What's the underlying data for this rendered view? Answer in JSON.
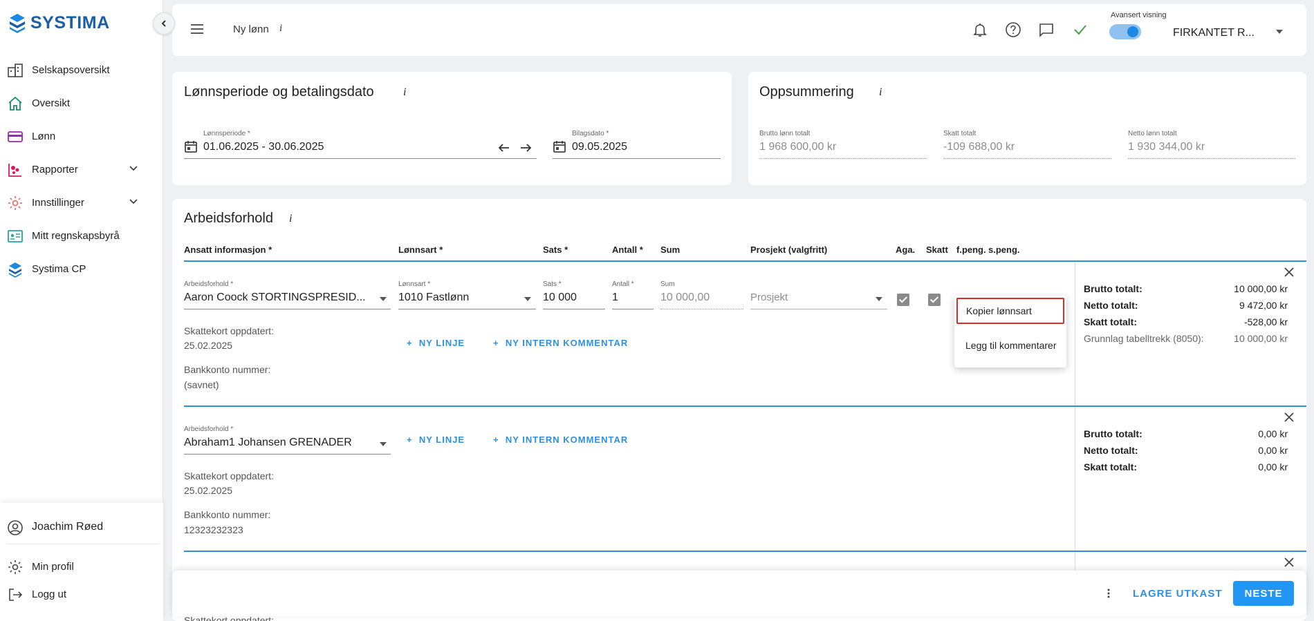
{
  "app": {
    "logo_text": "SYSTIMA",
    "accent": "#2196f3"
  },
  "sidebar": {
    "items": [
      {
        "label": "Selskapsoversikt",
        "icon": "company-building-icon"
      },
      {
        "label": "Oversikt",
        "icon": "home-icon"
      },
      {
        "label": "Lønn",
        "icon": "payment-card-icon"
      },
      {
        "label": "Rapporter",
        "icon": "reports-icon",
        "expandable": true
      },
      {
        "label": "Innstillinger",
        "icon": "gear-icon",
        "expandable": true
      },
      {
        "label": "Mitt regnskapsbyrå",
        "icon": "accounting-office-icon"
      },
      {
        "label": "Systima CP",
        "icon": "systima-logo-icon"
      }
    ],
    "user": {
      "name": "Joachim Røed"
    },
    "profile_label": "Min profil",
    "logout_label": "Logg ut"
  },
  "topbar": {
    "breadcrumb": "Ny lønn",
    "info": "i",
    "advanced_view_label": "Avansert visning",
    "advanced_view_on": true,
    "company": "FIRKANTET R..."
  },
  "period_card": {
    "title": "Lønnsperiode og betalingsdato",
    "info": "i",
    "period_label": "Lønnsperiode *",
    "period_value": "01.06.2025 - 30.06.2025",
    "voucher_date_label": "Bilagsdato *",
    "voucher_date_value": "09.05.2025"
  },
  "summary_card": {
    "title": "Oppsummering",
    "info": "i",
    "gross_label": "Brutto lønn totalt",
    "gross_value": "1 968 600,00 kr",
    "tax_label": "Skatt totalt",
    "tax_value": "-109 688,00 kr",
    "net_label": "Netto lønn totalt",
    "net_value": "1 930 344,00 kr"
  },
  "employment": {
    "title": "Arbeidsforhold",
    "info": "i",
    "columns": [
      "Ansatt informasjon *",
      "Lønnsart *",
      "Sats *",
      "Antall *",
      "Sum",
      "Prosjekt (valgfritt)",
      "Aga.",
      "Skatt",
      "f.peng.",
      "s.peng."
    ],
    "row1": {
      "employment_label": "Arbeidsforhold *",
      "employment_value": "Aaron Coock STORTINGSPRESID...",
      "wage_type_label": "Lønnsart *",
      "wage_type_value": "1010 Fastlønn",
      "rate_label": "Sats *",
      "rate_value": "10 000",
      "qty_label": "Antall *",
      "qty_value": "1",
      "sum_label": "Sum",
      "sum_value": "10 000,00",
      "project_placeholder": "Prosjekt",
      "taxcard_label": "Skattekort oppdatert:",
      "taxcard_date": "25.02.2025",
      "bank_label": "Bankkonto nummer:",
      "bank_value": "(savnet)",
      "add_line": "NY LINJE",
      "add_comment": "NY INTERN KOMMENTAR",
      "gross_label": "Brutto totalt:",
      "gross_value": "10 000,00 kr",
      "net_label": "Netto totalt:",
      "net_value": "9 472,00 kr",
      "tax_label": "Skatt totalt:",
      "tax_value": "-528,00 kr",
      "basis_label": "Grunnlag tabelltrekk (8050):",
      "basis_value": "10 000,00 kr"
    },
    "row2": {
      "employment_label": "Arbeidsforhold *",
      "employment_value": "Abraham1 Johansen GRENADER",
      "taxcard_label": "Skattekort oppdatert:",
      "taxcard_date": "25.02.2025",
      "bank_label": "Bankkonto nummer:",
      "bank_value": "12323232323",
      "add_line": "NY LINJE",
      "add_comment": "NY INTERN KOMMENTAR",
      "gross_label": "Brutto totalt:",
      "gross_value": "0,00 kr",
      "net_label": "Netto totalt:",
      "net_value": "0,00 kr",
      "tax_label": "Skatt totalt:",
      "tax_value": "0,00 kr"
    },
    "row3_partial": "Skattekort oppdatert:"
  },
  "context_menu": {
    "copy_wage_type": "Kopier lønnsart",
    "add_comments": "Legg til kommentarer"
  },
  "footer": {
    "save_draft": "LAGRE UTKAST",
    "next": "NESTE"
  }
}
